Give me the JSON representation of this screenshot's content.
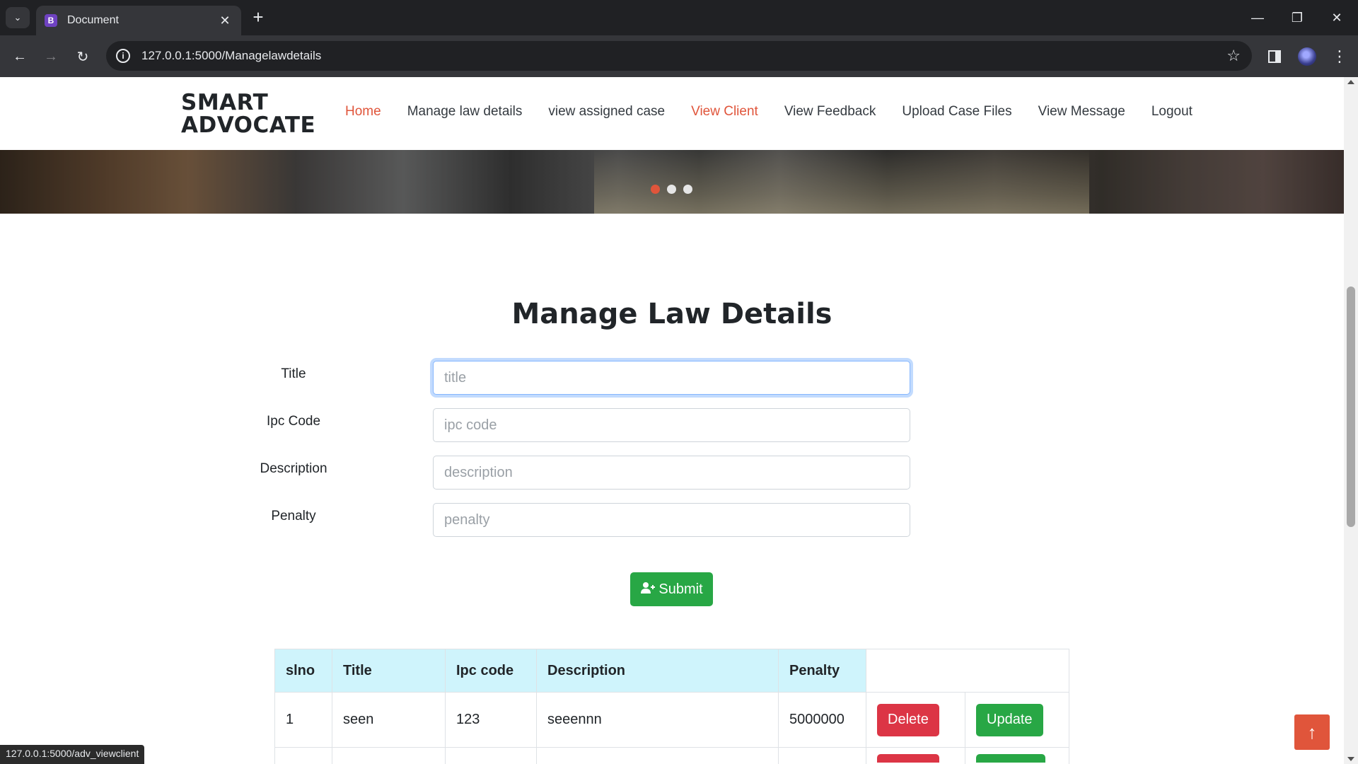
{
  "browser": {
    "tab_title": "Document",
    "tab_favicon_letter": "B",
    "url": "127.0.0.1:5000/Managelawdetails",
    "status_url": "127.0.0.1:5000/adv_viewclient"
  },
  "site": {
    "brand_line1": "SMART",
    "brand_line2": "ADVOCATE",
    "nav": [
      {
        "label": "Home",
        "active": true
      },
      {
        "label": "Manage law details",
        "active": false
      },
      {
        "label": "view assigned case",
        "active": false
      },
      {
        "label": "View Client",
        "active": true
      },
      {
        "label": "View Feedback",
        "active": false
      },
      {
        "label": "Upload Case Files",
        "active": false
      },
      {
        "label": "View Message",
        "active": false
      },
      {
        "label": "Logout",
        "active": false
      }
    ],
    "accent_color": "#e0553b",
    "carousel": {
      "slide_count": 3,
      "active_index": 0
    }
  },
  "main": {
    "title": "Manage Law Details",
    "form": {
      "fields": [
        {
          "label": "Title",
          "placeholder": "title",
          "value": ""
        },
        {
          "label": "Ipc Code",
          "placeholder": "ipc code",
          "value": ""
        },
        {
          "label": "Description",
          "placeholder": "description",
          "value": ""
        },
        {
          "label": "Penalty",
          "placeholder": "penalty",
          "value": ""
        }
      ],
      "submit_label": "Submit",
      "submit_icon": "user-plus-icon"
    },
    "table": {
      "headers": [
        "slno",
        "Title",
        "Ipc code",
        "Description",
        "Penalty"
      ],
      "rows": [
        {
          "slno": "1",
          "title": "seen",
          "ipc_code": "123",
          "description": "seeennn",
          "penalty": "5000000",
          "delete_label": "Delete",
          "update_label": "Update"
        }
      ]
    }
  }
}
